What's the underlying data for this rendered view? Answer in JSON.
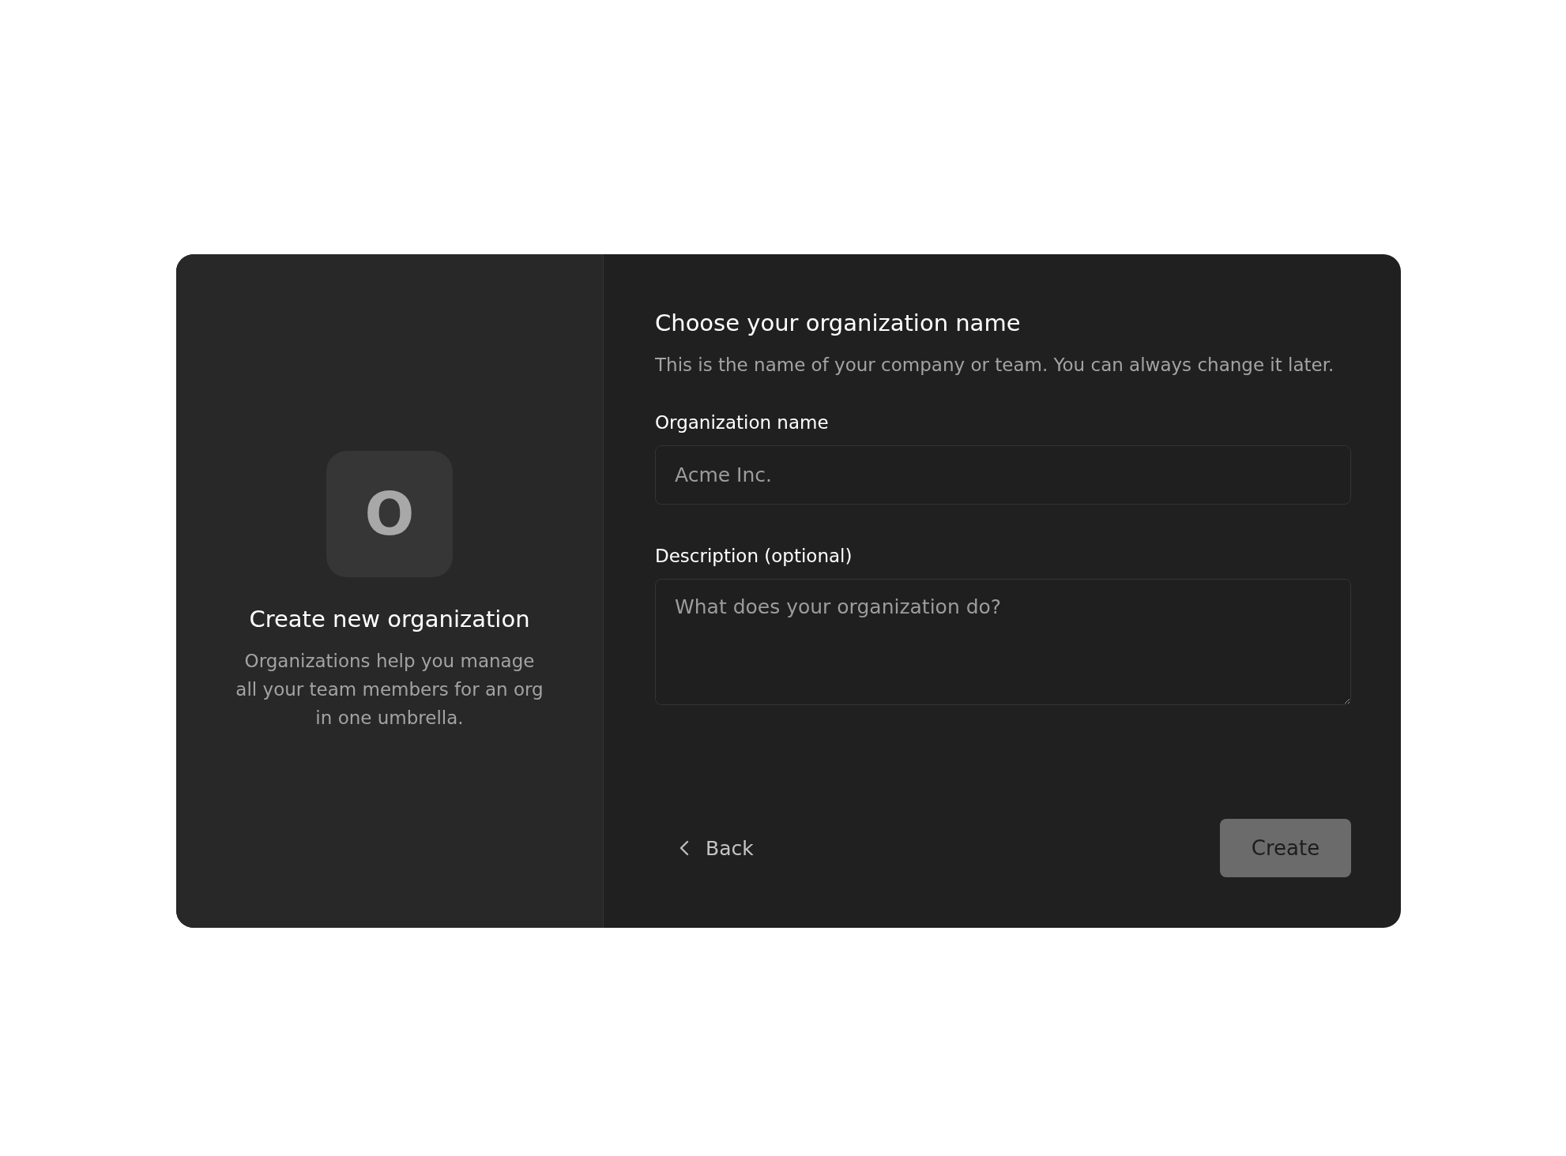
{
  "intro": {
    "avatar_letter": "O",
    "title": "Create new organization",
    "description": "Organizations help you manage all your team members for an org in one umbrella."
  },
  "form": {
    "title": "Choose your organization name",
    "description": "This is the name of your company or team. You can always change it later.",
    "fields": [
      {
        "kind": "input",
        "label": "Organization name",
        "placeholder": "Acme Inc."
      },
      {
        "kind": "textarea",
        "label": "Description (optional)",
        "placeholder": "What does your organization do?"
      }
    ],
    "back_button": "Back",
    "create_button": {
      "label": "Create",
      "disabled": true
    }
  }
}
